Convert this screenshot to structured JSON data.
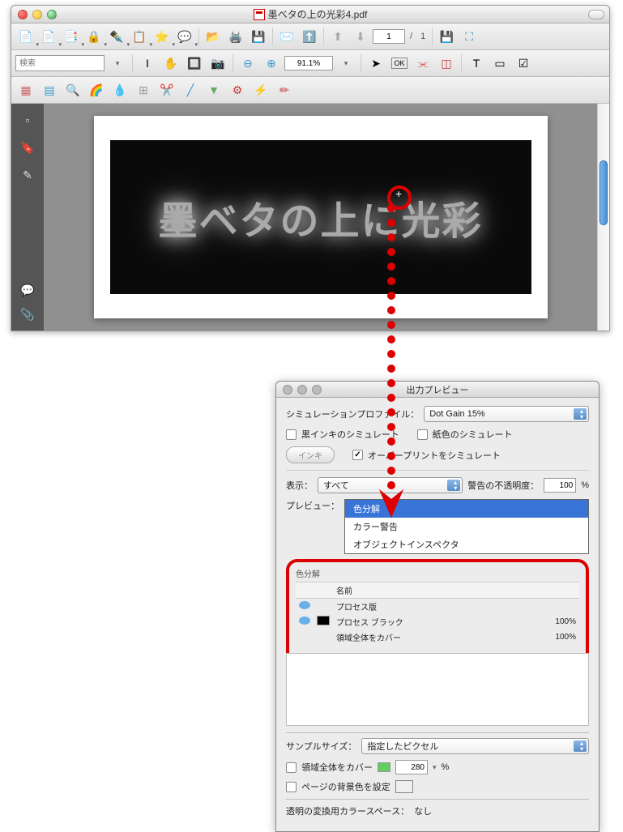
{
  "mainWindow": {
    "title": "墨ベタの上の光彩4.pdf",
    "pageCurrent": "1",
    "pageSep": "/",
    "pageTotal": "1",
    "searchPlaceholder": "検索",
    "zoom": "91.1%",
    "docText": "墨ベタの上に光彩"
  },
  "panel": {
    "title": "出力プレビュー",
    "simProfileLabel": "シミュレーションプロファイル：",
    "simProfileValue": "Dot Gain 15%",
    "blackInkSim": "黒インキのシミュレート",
    "paperSim": "紙色のシミュレート",
    "inkButton": "インキ",
    "overprintSim": "オーバープリントをシミュレート",
    "showLabel": "表示：",
    "showValue": "すべて",
    "warnOpacityLabel": "警告の不透明度：",
    "warnOpacityValue": "100",
    "percent": "%",
    "previewLabel": "プレビュー：",
    "previewOptions": [
      "色分解",
      "カラー警告",
      "オブジェクトインスペクタ"
    ],
    "sectionTitle": "色分解",
    "columns": {
      "name": "名前"
    },
    "rows": [
      {
        "name": "プロセス版",
        "value": ""
      },
      {
        "name": "プロセス ブラック",
        "value": "100%"
      },
      {
        "name": "領域全体をカバー",
        "value": "100%"
      }
    ],
    "sampleSizeLabel": "サンプルサイズ：",
    "sampleSizeValue": "指定したピクセル",
    "totalCoverLabel": "領域全体をカバー",
    "totalCoverValue": "280",
    "pageBgLabel": "ページの背景色を設定",
    "transparencyLabel": "透明の変換用カラースペース：",
    "transparencyValue": "なし"
  }
}
